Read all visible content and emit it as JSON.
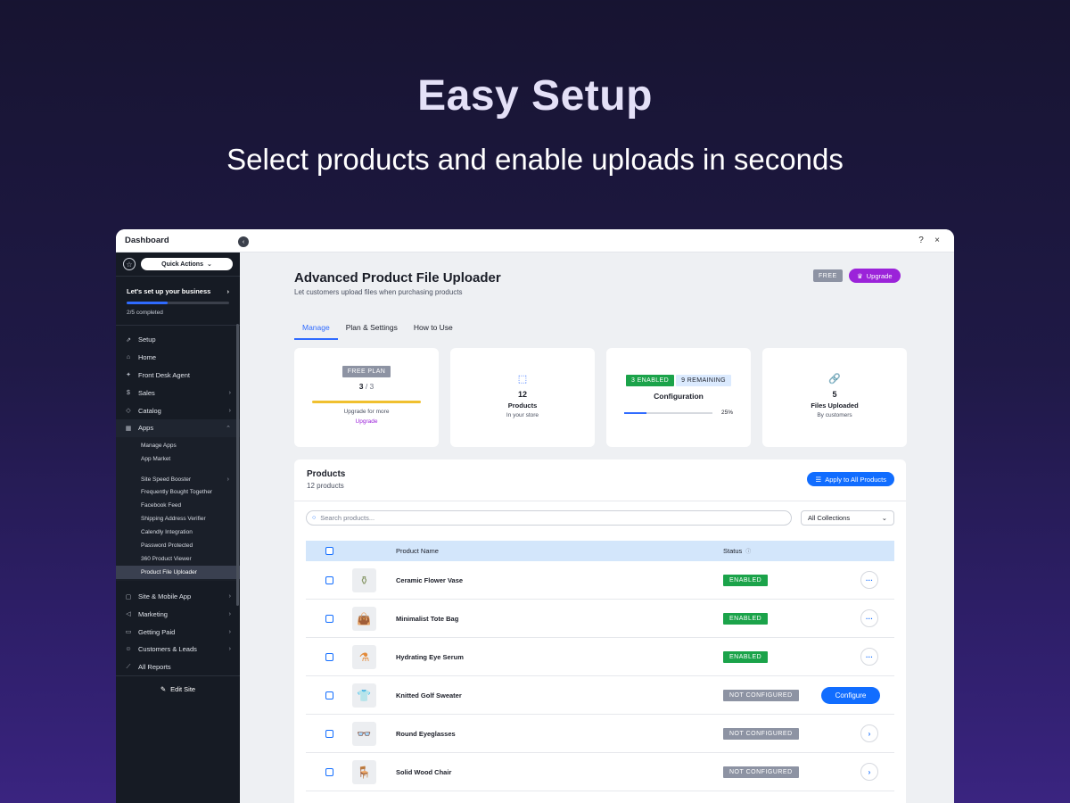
{
  "hero": {
    "headline": "Easy Setup",
    "subhead": "Select products and enable uploads in seconds"
  },
  "window": {
    "title": "Dashboard",
    "help_icon": "?",
    "close_icon": "×"
  },
  "sidebar": {
    "quick_actions": "Quick Actions",
    "setup_title": "Let's set up your business",
    "setup_progress": 0.4,
    "setup_count": "2/5 completed",
    "items": [
      {
        "label": "Setup",
        "icon": "rocket-icon",
        "glyph": "⇗",
        "chevron": ""
      },
      {
        "label": "Home",
        "icon": "home-icon",
        "glyph": "⌂",
        "chevron": ""
      },
      {
        "label": "Front Desk Agent",
        "icon": "sparkle-icon",
        "glyph": "✦",
        "chevron": ""
      },
      {
        "label": "Sales",
        "icon": "dollar-icon",
        "glyph": "$",
        "chevron": "›"
      },
      {
        "label": "Catalog",
        "icon": "tag-icon",
        "glyph": "◇",
        "chevron": "›"
      },
      {
        "label": "Apps",
        "icon": "apps-icon",
        "glyph": "▦",
        "chevron": "⌃"
      }
    ],
    "apps_sub": [
      "Manage Apps",
      "App Market"
    ],
    "apps_list": [
      "Site Speed Booster",
      "Frequently Bought Together",
      "Facebook Feed",
      "Shipping Address Verifier",
      "Calendly Integration",
      "Password Protected",
      "360 Product Viewer",
      "Product File Uploader"
    ],
    "items_bottom": [
      {
        "label": "Site & Mobile App",
        "icon": "mobile-icon",
        "glyph": "▢",
        "chevron": "›"
      },
      {
        "label": "Marketing",
        "icon": "megaphone-icon",
        "glyph": "◁",
        "chevron": "›"
      },
      {
        "label": "Getting Paid",
        "icon": "card-icon",
        "glyph": "▭",
        "chevron": "›"
      },
      {
        "label": "Customers & Leads",
        "icon": "people-icon",
        "glyph": "☺",
        "chevron": "›"
      },
      {
        "label": "All Reports",
        "icon": "chart-icon",
        "glyph": "⟋",
        "chevron": ""
      }
    ],
    "edit_site": "Edit Site"
  },
  "app": {
    "title": "Advanced Product File Uploader",
    "subtitle": "Let customers upload files when purchasing products",
    "plan_badge": "FREE",
    "upgrade_label": "Upgrade",
    "tabs": [
      "Manage",
      "Plan & Settings",
      "How to Use"
    ]
  },
  "cards": {
    "plan": {
      "chip": "FREE PLAN",
      "used": "3",
      "total": "/ 3",
      "note": "Upgrade for more",
      "link": "Upgrade"
    },
    "products": {
      "count": "12",
      "label": "Products",
      "sub": "In your store"
    },
    "configuration": {
      "enabled": "3 ENABLED",
      "remaining": "9 REMAINING",
      "label": "Configuration",
      "progress": 0.25,
      "percent": "25%"
    },
    "files": {
      "count": "5",
      "label": "Files Uploaded",
      "sub": "By customers"
    }
  },
  "products": {
    "title": "Products",
    "count": "12 products",
    "apply_label": "Apply to All Products",
    "search_placeholder": "Search products...",
    "collection": "All Collections",
    "col_name": "Product Name",
    "col_status": "Status",
    "configure_label": "Configure",
    "rows": [
      {
        "name": "Ceramic Flower Vase",
        "status": "ENABLED",
        "thumb": "⚱",
        "color": "#8a9a6b"
      },
      {
        "name": "Minimalist Tote Bag",
        "status": "ENABLED",
        "thumb": "👜",
        "color": "#9aa3c4"
      },
      {
        "name": "Hydrating Eye Serum",
        "status": "ENABLED",
        "thumb": "⚗",
        "color": "#e38a3a"
      },
      {
        "name": "Knitted Golf Sweater",
        "status": "NOT CONFIGURED",
        "thumb": "👕",
        "color": "#2f5a3e"
      },
      {
        "name": "Round Eyeglasses",
        "status": "NOT CONFIGURED",
        "thumb": "👓",
        "color": "#222222"
      },
      {
        "name": "Solid Wood Chair",
        "status": "NOT CONFIGURED",
        "thumb": "🪑",
        "color": "#e0602a"
      }
    ]
  }
}
